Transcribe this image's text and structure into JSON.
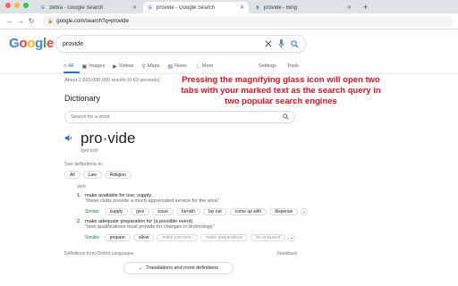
{
  "browser": {
    "tabs": [
      {
        "title": "zebra - Google Search",
        "favicon": "google-g-icon",
        "active": false
      },
      {
        "title": "provide - Google Search",
        "favicon": "google-g-icon",
        "active": true
      },
      {
        "title": "provide - Bing",
        "favicon": "bing-b-icon",
        "active": false
      }
    ],
    "new_tab": "+",
    "url": "google.com/search?q=provide"
  },
  "google": {
    "logo": "Google",
    "logo_colors": [
      "#4285F4",
      "#EA4335",
      "#FBBC05",
      "#4285F4",
      "#34A853",
      "#EA4335"
    ],
    "query": "provide",
    "nav_tabs": [
      "All",
      "Images",
      "Videos",
      "Maps",
      "News",
      "More"
    ],
    "settings": "Settings",
    "tools": "Tools",
    "stats": "About 2,920,000,000 results (0.63 seconds)"
  },
  "annotation": "Pressing the magnifying glass icon will open two tabs with your marked text as the search query in two popular search engines",
  "dictionary": {
    "heading": "Dictionary",
    "search_placeholder": "Search for a word",
    "word": "pro·vide",
    "phonetic": "/prə'vīd/",
    "see_definitions": "See definitions in:",
    "definition_chips": [
      "All",
      "Law",
      "Religion"
    ],
    "part_of_speech": "verb",
    "senses": [
      {
        "num": "1.",
        "definition": "make available for use; supply.",
        "example": "\"these clubs provide a much appreciated service for the area\"",
        "similar_label": "Similar:",
        "similar": [
          "supply",
          "give",
          "issue",
          "furnish",
          "lay out",
          "come up with",
          "dispense"
        ]
      },
      {
        "num": "2.",
        "definition": "make adequate preparation for (a possible event).",
        "example": "\"new qualifications must provide for changes in technology\"",
        "similar_label": "Similar:",
        "similar": [
          "prepare",
          "allow",
          "make provision",
          "make preparations",
          "be prepared"
        ]
      }
    ],
    "source": "Definitions from Oxford Languages",
    "feedback": "Feedback",
    "more_button": "Translations and more definitions"
  },
  "colors": {
    "accent": "#1a73e8",
    "annotation": "#e8121e",
    "similar_label": "#1f7c3e"
  }
}
